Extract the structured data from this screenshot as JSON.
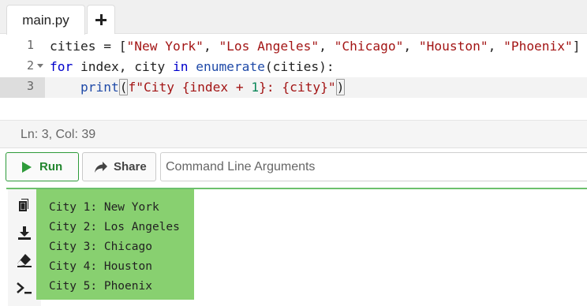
{
  "tabs": {
    "file_name": "main.py",
    "add_label": "+"
  },
  "editor": {
    "active_line": 3,
    "lines": [
      {
        "number": "1",
        "foldable": false,
        "tokens": [
          {
            "t": "plain",
            "v": "cities = ["
          },
          {
            "t": "str",
            "v": "\"New York\""
          },
          {
            "t": "plain",
            "v": ", "
          },
          {
            "t": "str",
            "v": "\"Los Angeles\""
          },
          {
            "t": "plain",
            "v": ", "
          },
          {
            "t": "str",
            "v": "\"Chicago\""
          },
          {
            "t": "plain",
            "v": ", "
          },
          {
            "t": "str",
            "v": "\"Houston\""
          },
          {
            "t": "plain",
            "v": ", "
          },
          {
            "t": "str",
            "v": "\"Phoenix\""
          },
          {
            "t": "plain",
            "v": "]"
          }
        ]
      },
      {
        "number": "2",
        "foldable": true,
        "tokens": [
          {
            "t": "kw",
            "v": "for"
          },
          {
            "t": "plain",
            "v": " index, city "
          },
          {
            "t": "kw",
            "v": "in"
          },
          {
            "t": "plain",
            "v": " "
          },
          {
            "t": "fn",
            "v": "enumerate"
          },
          {
            "t": "plain",
            "v": "(cities):"
          }
        ]
      },
      {
        "number": "3",
        "foldable": false,
        "tokens": [
          {
            "t": "plain",
            "v": "    "
          },
          {
            "t": "fn",
            "v": "print"
          },
          {
            "t": "cursor",
            "v": "("
          },
          {
            "t": "str",
            "v": "f\"City {index + "
          },
          {
            "t": "num",
            "v": "1"
          },
          {
            "t": "str",
            "v": "}: {city}\""
          },
          {
            "t": "cursor",
            "v": ")"
          }
        ]
      }
    ]
  },
  "status": {
    "cursor_position": "Ln: 3,  Col: 39"
  },
  "actions": {
    "run_label": "Run",
    "share_label": "Share",
    "args_placeholder": "Command Line Arguments",
    "args_value": ""
  },
  "output": {
    "toolbar_icons": [
      "copy-icon",
      "download-icon",
      "eraser-icon",
      "terminal-icon"
    ],
    "lines": [
      "City 1: New York",
      "City 2: Los Angeles",
      "City 3: Chicago",
      "City 4: Houston",
      "City 5: Phoenix"
    ]
  },
  "colors": {
    "run_accent": "#2e9b3a",
    "output_highlight": "#88d070",
    "keyword": "#0000cc",
    "string": "#a31515",
    "number": "#098658"
  }
}
